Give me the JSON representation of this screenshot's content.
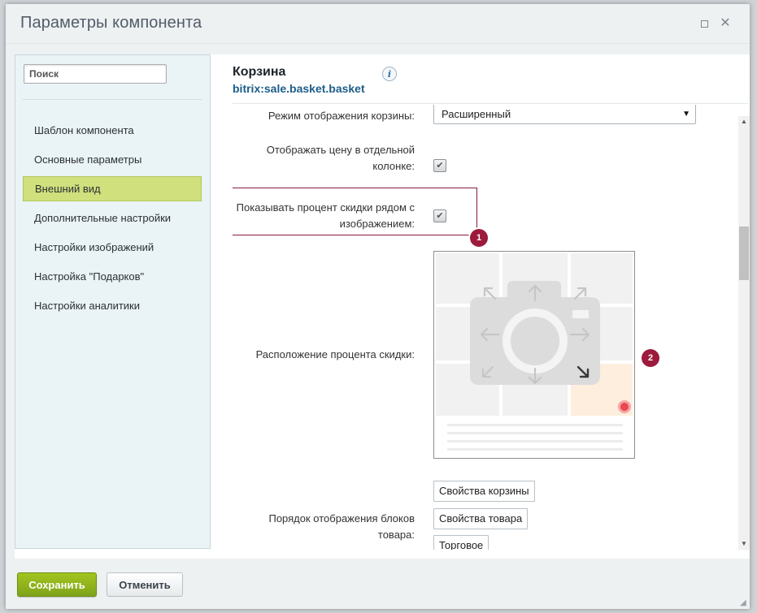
{
  "window": {
    "title": "Параметры компонента"
  },
  "sidebar": {
    "search_placeholder": "Поиск",
    "items": [
      {
        "label": "Шаблон компонента",
        "active": false
      },
      {
        "label": "Основные параметры",
        "active": false
      },
      {
        "label": "Внешний вид",
        "active": true
      },
      {
        "label": "Дополнительные настройки",
        "active": false
      },
      {
        "label": "Настройки изображений",
        "active": false
      },
      {
        "label": "Настройка \"Подарков\"",
        "active": false
      },
      {
        "label": "Настройки аналитики",
        "active": false
      }
    ]
  },
  "component": {
    "title": "Корзина",
    "code": "bitrix:sale.basket.basket",
    "info_glyph": "i"
  },
  "params": {
    "display_mode": {
      "label": "Режим отображения корзины:",
      "value": "Расширенный"
    },
    "price_column": {
      "label_line1": "Отображать цену в отдельной",
      "label_line2": "колонке:",
      "checked": true
    },
    "discount_near_image": {
      "label_line1": "Показывать процент скидки рядом с",
      "label_line2": "изображением:",
      "checked": true
    },
    "discount_position": {
      "label": "Расположение процента скидки:",
      "selected": "bottom-right"
    },
    "block_order": {
      "label_line1": "Порядок отображения блоков",
      "label_line2": "товара:",
      "buttons": [
        "Свойства корзины",
        "Свойства товара",
        "Торговое"
      ]
    }
  },
  "annotations": {
    "badge1": "1",
    "badge2": "2"
  },
  "footer": {
    "save_label": "Сохранить",
    "cancel_label": "Отменить"
  },
  "colors": {
    "accent_green": "#8fb11d",
    "sidebar_active": "#cfe07c",
    "annotation_red": "#9c1a3c",
    "link_blue": "#1d5d8a"
  }
}
